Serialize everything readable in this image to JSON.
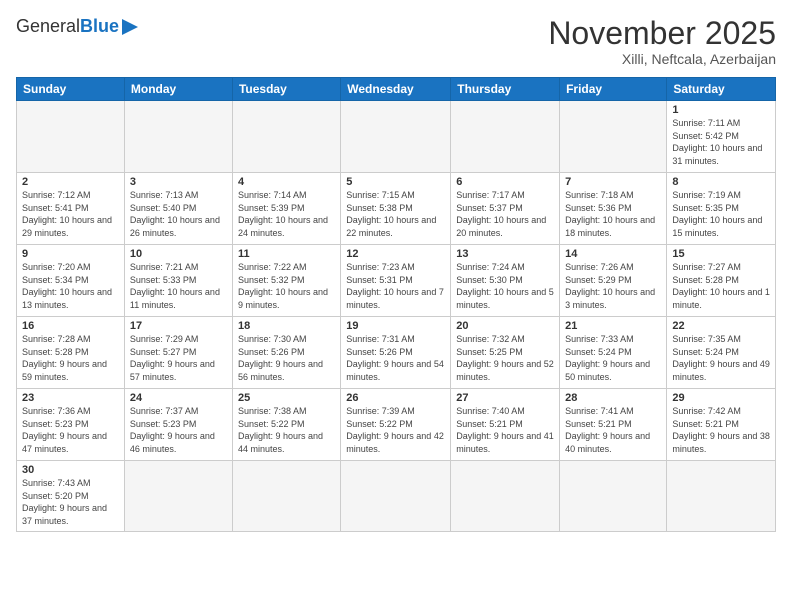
{
  "logo": {
    "general": "General",
    "blue": "Blue"
  },
  "header": {
    "month_title": "November 2025",
    "subtitle": "Xilli, Neftcala, Azerbaijan"
  },
  "days_of_week": [
    "Sunday",
    "Monday",
    "Tuesday",
    "Wednesday",
    "Thursday",
    "Friday",
    "Saturday"
  ],
  "weeks": [
    [
      {
        "day": "",
        "info": ""
      },
      {
        "day": "",
        "info": ""
      },
      {
        "day": "",
        "info": ""
      },
      {
        "day": "",
        "info": ""
      },
      {
        "day": "",
        "info": ""
      },
      {
        "day": "",
        "info": ""
      },
      {
        "day": "1",
        "info": "Sunrise: 7:11 AM\nSunset: 5:42 PM\nDaylight: 10 hours and 31 minutes."
      }
    ],
    [
      {
        "day": "2",
        "info": "Sunrise: 7:12 AM\nSunset: 5:41 PM\nDaylight: 10 hours and 29 minutes."
      },
      {
        "day": "3",
        "info": "Sunrise: 7:13 AM\nSunset: 5:40 PM\nDaylight: 10 hours and 26 minutes."
      },
      {
        "day": "4",
        "info": "Sunrise: 7:14 AM\nSunset: 5:39 PM\nDaylight: 10 hours and 24 minutes."
      },
      {
        "day": "5",
        "info": "Sunrise: 7:15 AM\nSunset: 5:38 PM\nDaylight: 10 hours and 22 minutes."
      },
      {
        "day": "6",
        "info": "Sunrise: 7:17 AM\nSunset: 5:37 PM\nDaylight: 10 hours and 20 minutes."
      },
      {
        "day": "7",
        "info": "Sunrise: 7:18 AM\nSunset: 5:36 PM\nDaylight: 10 hours and 18 minutes."
      },
      {
        "day": "8",
        "info": "Sunrise: 7:19 AM\nSunset: 5:35 PM\nDaylight: 10 hours and 15 minutes."
      }
    ],
    [
      {
        "day": "9",
        "info": "Sunrise: 7:20 AM\nSunset: 5:34 PM\nDaylight: 10 hours and 13 minutes."
      },
      {
        "day": "10",
        "info": "Sunrise: 7:21 AM\nSunset: 5:33 PM\nDaylight: 10 hours and 11 minutes."
      },
      {
        "day": "11",
        "info": "Sunrise: 7:22 AM\nSunset: 5:32 PM\nDaylight: 10 hours and 9 minutes."
      },
      {
        "day": "12",
        "info": "Sunrise: 7:23 AM\nSunset: 5:31 PM\nDaylight: 10 hours and 7 minutes."
      },
      {
        "day": "13",
        "info": "Sunrise: 7:24 AM\nSunset: 5:30 PM\nDaylight: 10 hours and 5 minutes."
      },
      {
        "day": "14",
        "info": "Sunrise: 7:26 AM\nSunset: 5:29 PM\nDaylight: 10 hours and 3 minutes."
      },
      {
        "day": "15",
        "info": "Sunrise: 7:27 AM\nSunset: 5:28 PM\nDaylight: 10 hours and 1 minute."
      }
    ],
    [
      {
        "day": "16",
        "info": "Sunrise: 7:28 AM\nSunset: 5:28 PM\nDaylight: 9 hours and 59 minutes."
      },
      {
        "day": "17",
        "info": "Sunrise: 7:29 AM\nSunset: 5:27 PM\nDaylight: 9 hours and 57 minutes."
      },
      {
        "day": "18",
        "info": "Sunrise: 7:30 AM\nSunset: 5:26 PM\nDaylight: 9 hours and 56 minutes."
      },
      {
        "day": "19",
        "info": "Sunrise: 7:31 AM\nSunset: 5:26 PM\nDaylight: 9 hours and 54 minutes."
      },
      {
        "day": "20",
        "info": "Sunrise: 7:32 AM\nSunset: 5:25 PM\nDaylight: 9 hours and 52 minutes."
      },
      {
        "day": "21",
        "info": "Sunrise: 7:33 AM\nSunset: 5:24 PM\nDaylight: 9 hours and 50 minutes."
      },
      {
        "day": "22",
        "info": "Sunrise: 7:35 AM\nSunset: 5:24 PM\nDaylight: 9 hours and 49 minutes."
      }
    ],
    [
      {
        "day": "23",
        "info": "Sunrise: 7:36 AM\nSunset: 5:23 PM\nDaylight: 9 hours and 47 minutes."
      },
      {
        "day": "24",
        "info": "Sunrise: 7:37 AM\nSunset: 5:23 PM\nDaylight: 9 hours and 46 minutes."
      },
      {
        "day": "25",
        "info": "Sunrise: 7:38 AM\nSunset: 5:22 PM\nDaylight: 9 hours and 44 minutes."
      },
      {
        "day": "26",
        "info": "Sunrise: 7:39 AM\nSunset: 5:22 PM\nDaylight: 9 hours and 42 minutes."
      },
      {
        "day": "27",
        "info": "Sunrise: 7:40 AM\nSunset: 5:21 PM\nDaylight: 9 hours and 41 minutes."
      },
      {
        "day": "28",
        "info": "Sunrise: 7:41 AM\nSunset: 5:21 PM\nDaylight: 9 hours and 40 minutes."
      },
      {
        "day": "29",
        "info": "Sunrise: 7:42 AM\nSunset: 5:21 PM\nDaylight: 9 hours and 38 minutes."
      }
    ],
    [
      {
        "day": "30",
        "info": "Sunrise: 7:43 AM\nSunset: 5:20 PM\nDaylight: 9 hours and 37 minutes."
      },
      {
        "day": "",
        "info": ""
      },
      {
        "day": "",
        "info": ""
      },
      {
        "day": "",
        "info": ""
      },
      {
        "day": "",
        "info": ""
      },
      {
        "day": "",
        "info": ""
      },
      {
        "day": "",
        "info": ""
      }
    ]
  ]
}
